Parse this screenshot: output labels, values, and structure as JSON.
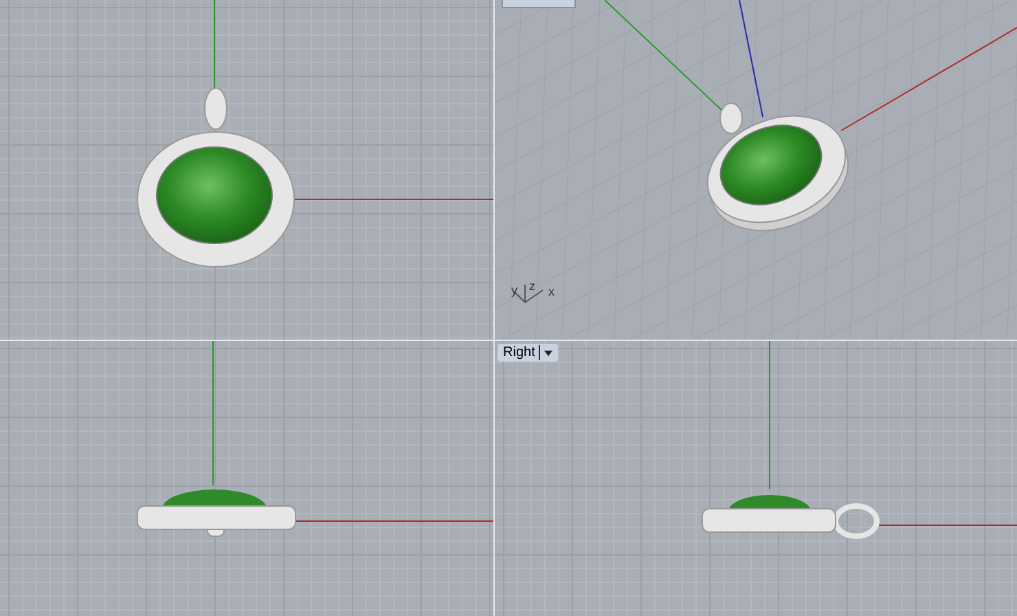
{
  "viewports": [
    {
      "kind": "top"
    },
    {
      "kind": "perspective",
      "axis_labels": [
        "y",
        "z",
        "x"
      ]
    },
    {
      "kind": "front"
    },
    {
      "kind": "right",
      "label": "Right"
    }
  ]
}
